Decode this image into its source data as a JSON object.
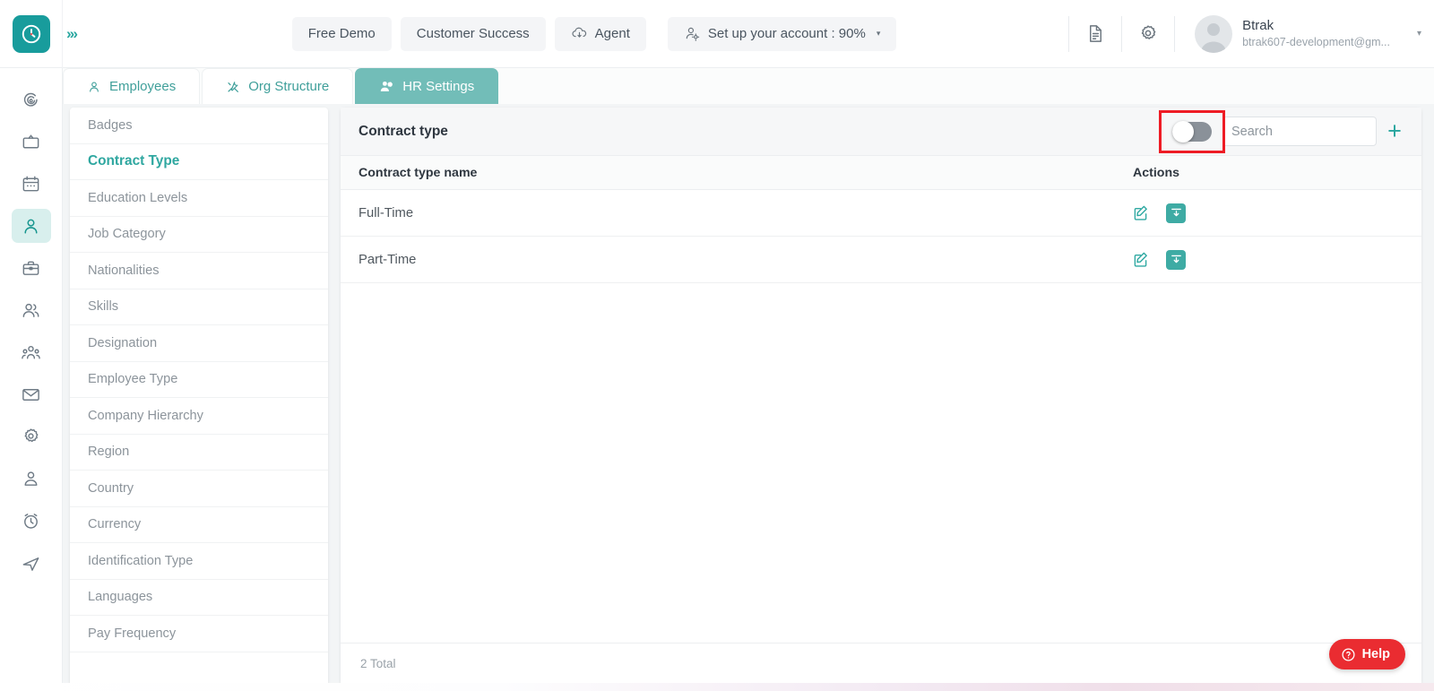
{
  "brand": {
    "logo_icon": "clock-logo-icon",
    "expand_icon": "triple-chevron-right-icon",
    "accent_teal": "#189c9c",
    "accent_teal_light": "#3eaba4",
    "highlight_red": "#ee1c25"
  },
  "topbar": {
    "buttons": [
      {
        "label": "Free Demo",
        "icon": null,
        "name": "free-demo-button"
      },
      {
        "label": "Customer Success",
        "icon": null,
        "name": "customer-success-button"
      },
      {
        "label": "Agent",
        "icon": "cloud-download-icon",
        "name": "agent-button"
      }
    ],
    "setup": {
      "label": "Set up your account : 90%",
      "icon": "user-gear-icon",
      "caret": "▾",
      "percent": "90%"
    },
    "icons": [
      {
        "name": "document-icon",
        "label": "Documents"
      },
      {
        "name": "gear-icon",
        "label": "Settings"
      }
    ],
    "user": {
      "name": "Btrak",
      "email": "btrak607-development@gm...",
      "avatar_icon": "avatar-placeholder-icon",
      "caret": "▾"
    }
  },
  "rail": {
    "items": [
      {
        "name": "sidebar-rail-dashboard",
        "icon": "target-spiral-icon",
        "active": false
      },
      {
        "name": "sidebar-rail-screen",
        "icon": "tv-icon",
        "active": false
      },
      {
        "name": "sidebar-rail-calendar",
        "icon": "calendar-icon",
        "active": false
      },
      {
        "name": "sidebar-rail-employees",
        "icon": "person-icon",
        "active": true
      },
      {
        "name": "sidebar-rail-jobs",
        "icon": "briefcase-icon",
        "active": false
      },
      {
        "name": "sidebar-rail-teams",
        "icon": "two-people-icon",
        "active": false
      },
      {
        "name": "sidebar-rail-org",
        "icon": "group-people-icon",
        "active": false
      },
      {
        "name": "sidebar-rail-mail",
        "icon": "envelope-icon",
        "active": false
      },
      {
        "name": "sidebar-rail-settings",
        "icon": "gear-icon",
        "active": false
      },
      {
        "name": "sidebar-rail-profile",
        "icon": "user-badge-icon",
        "active": false
      },
      {
        "name": "sidebar-rail-time",
        "icon": "alarm-clock-icon",
        "active": false
      },
      {
        "name": "sidebar-rail-send",
        "icon": "paper-plane-icon",
        "active": false
      }
    ]
  },
  "tabs": [
    {
      "label": "Employees",
      "icon": "person-icon",
      "active": false
    },
    {
      "label": "Org Structure",
      "icon": "tools-icon",
      "active": false
    },
    {
      "label": "HR Settings",
      "icon": "people-settings-icon",
      "active": true
    }
  ],
  "settings_menu": {
    "items": [
      {
        "label": "Badges",
        "active": false
      },
      {
        "label": "Contract Type",
        "active": true
      },
      {
        "label": "Education Levels",
        "active": false
      },
      {
        "label": "Job Category",
        "active": false
      },
      {
        "label": "Nationalities",
        "active": false
      },
      {
        "label": "Skills",
        "active": false
      },
      {
        "label": "Designation",
        "active": false
      },
      {
        "label": "Employee Type",
        "active": false
      },
      {
        "label": "Company Hierarchy",
        "active": false
      },
      {
        "label": "Region",
        "active": false
      },
      {
        "label": "Country",
        "active": false
      },
      {
        "label": "Currency",
        "active": false
      },
      {
        "label": "Identification Type",
        "active": false
      },
      {
        "label": "Languages",
        "active": false
      },
      {
        "label": "Pay Frequency",
        "active": false
      }
    ]
  },
  "panel": {
    "title": "Contract type",
    "toggle": {
      "name": "show-archived-toggle",
      "state": "off",
      "highlighted": true
    },
    "search": {
      "placeholder": "Search",
      "value": ""
    },
    "add_button": {
      "icon": "plus-icon",
      "label": "+"
    },
    "columns": [
      "Contract type name",
      "Actions"
    ],
    "rows": [
      {
        "name": "Full-Time",
        "actions": [
          "edit-icon",
          "archive-icon"
        ]
      },
      {
        "name": "Part-Time",
        "actions": [
          "edit-icon",
          "archive-icon"
        ]
      }
    ],
    "footer_total": "2 Total"
  },
  "help": {
    "label": "Help",
    "icon": "question-circle-icon"
  }
}
